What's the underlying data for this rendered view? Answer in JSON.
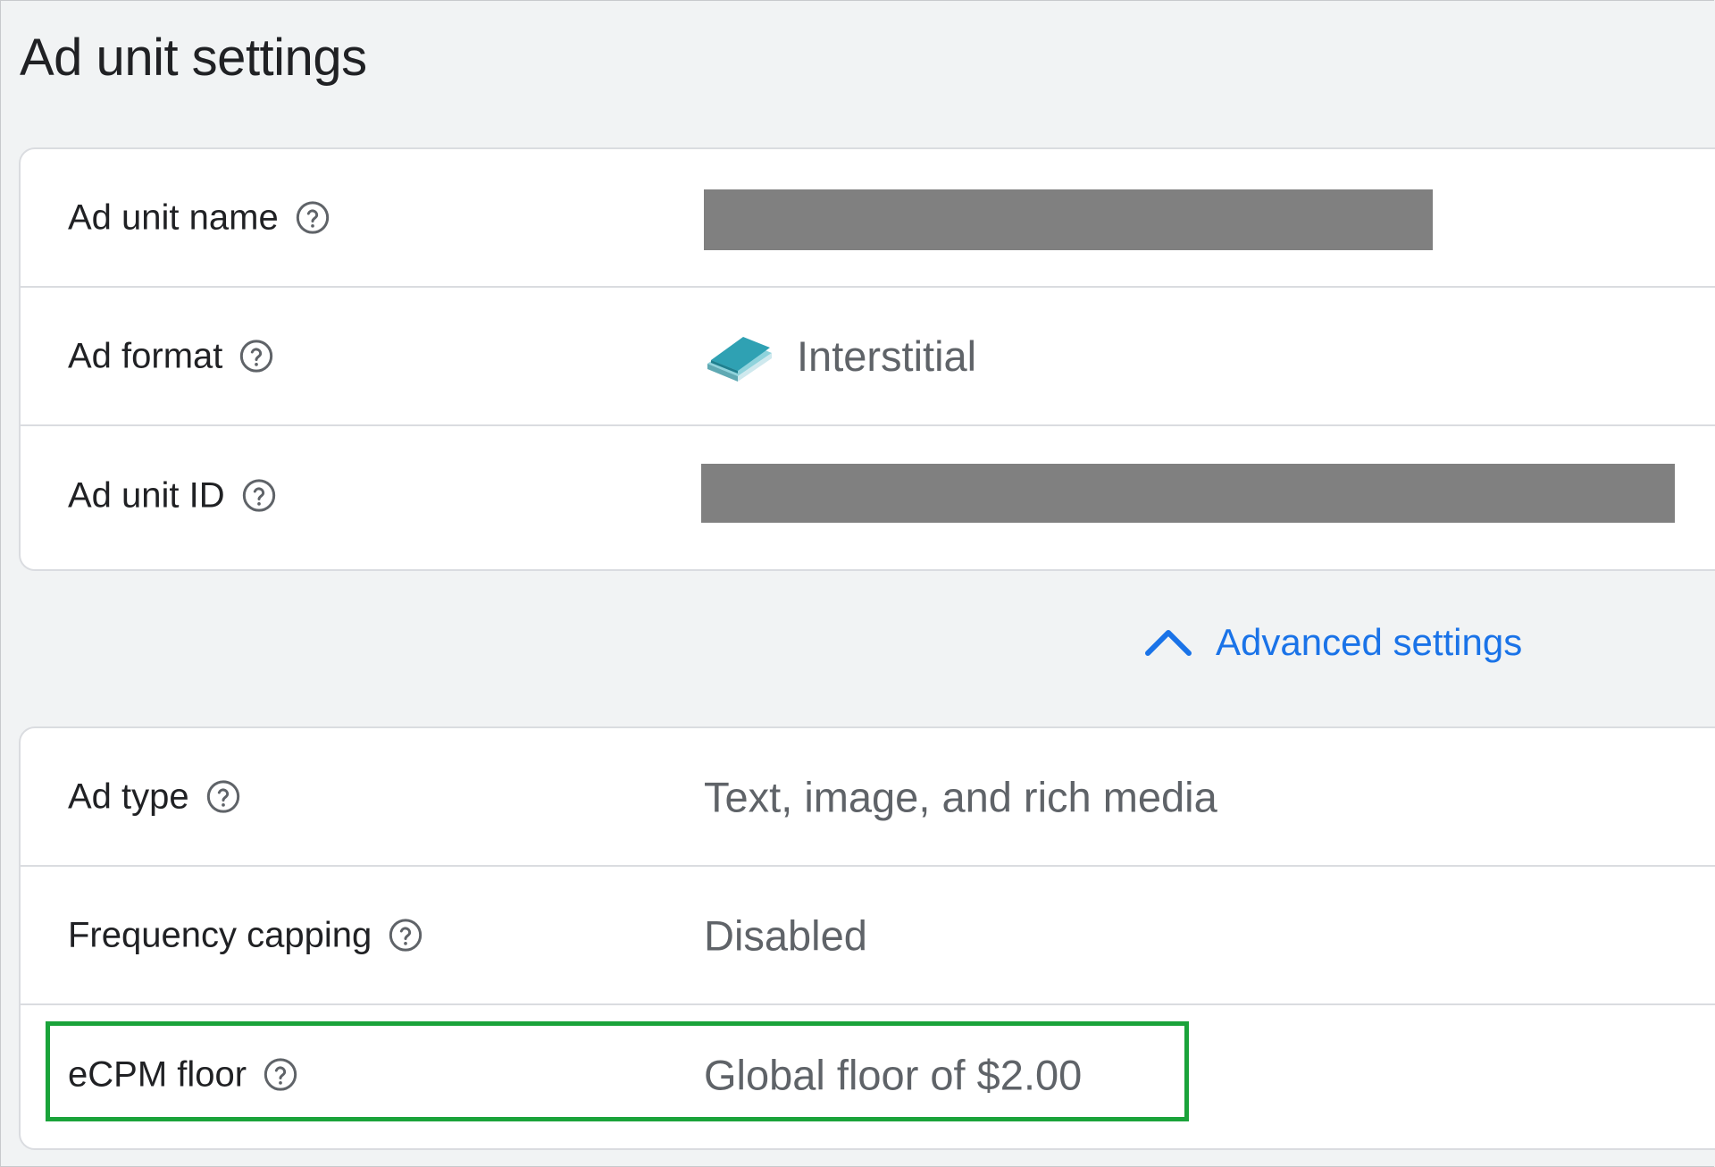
{
  "page": {
    "title": "Ad unit settings"
  },
  "settings": {
    "rows": [
      {
        "label": "Ad unit name",
        "value": "",
        "redacted": true
      },
      {
        "label": "Ad format",
        "value": "Interstitial",
        "icon": "interstitial-format-icon"
      },
      {
        "label": "Ad unit ID",
        "value": "",
        "redacted": true
      }
    ]
  },
  "advanced": {
    "label": "Advanced settings",
    "icon": "chevron-up-icon",
    "expanded": true
  },
  "advanced_settings": {
    "rows": [
      {
        "label": "Ad type",
        "value": "Text, image, and rich media"
      },
      {
        "label": "Frequency capping",
        "value": "Disabled"
      },
      {
        "label": "eCPM floor",
        "value": "Global floor of $2.00",
        "highlighted": true
      }
    ]
  },
  "colors": {
    "link": "#1a73e8",
    "highlight_border": "#1aa33a",
    "redaction": "#808080",
    "value_text": "#5f6368"
  }
}
